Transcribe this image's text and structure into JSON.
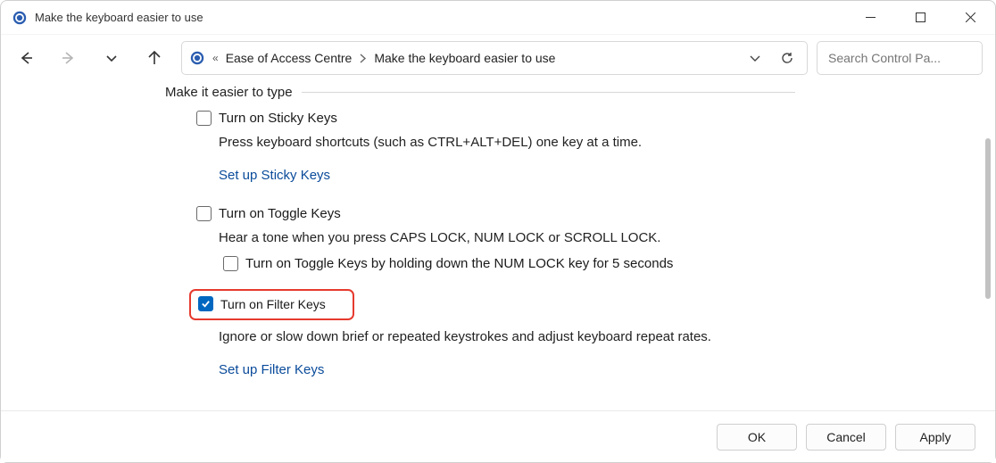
{
  "window": {
    "title": "Make the keyboard easier to use"
  },
  "breadcrumb": {
    "item1": "Ease of Access Centre",
    "item2": "Make the keyboard easier to use"
  },
  "search": {
    "placeholder": "Search Control Pa..."
  },
  "main": {
    "section_heading": "Make it easier to type",
    "sticky": {
      "label": "Turn on Sticky Keys",
      "desc": "Press keyboard shortcuts (such as CTRL+ALT+DEL) one key at a time.",
      "link": "Set up Sticky Keys"
    },
    "toggle": {
      "label": "Turn on Toggle Keys",
      "desc": "Hear a tone when you press CAPS LOCK, NUM LOCK or SCROLL LOCK.",
      "sub_label": "Turn on Toggle Keys by holding down the NUM LOCK key for 5 seconds"
    },
    "filter": {
      "label": "Turn on Filter Keys",
      "desc": "Ignore or slow down brief or repeated keystrokes and adjust keyboard repeat rates.",
      "link": "Set up Filter Keys"
    }
  },
  "buttons": {
    "ok": "OK",
    "cancel": "Cancel",
    "apply": "Apply"
  },
  "state": {
    "sticky_checked": false,
    "toggle_checked": false,
    "toggle_sub_checked": false,
    "filter_checked": true
  }
}
